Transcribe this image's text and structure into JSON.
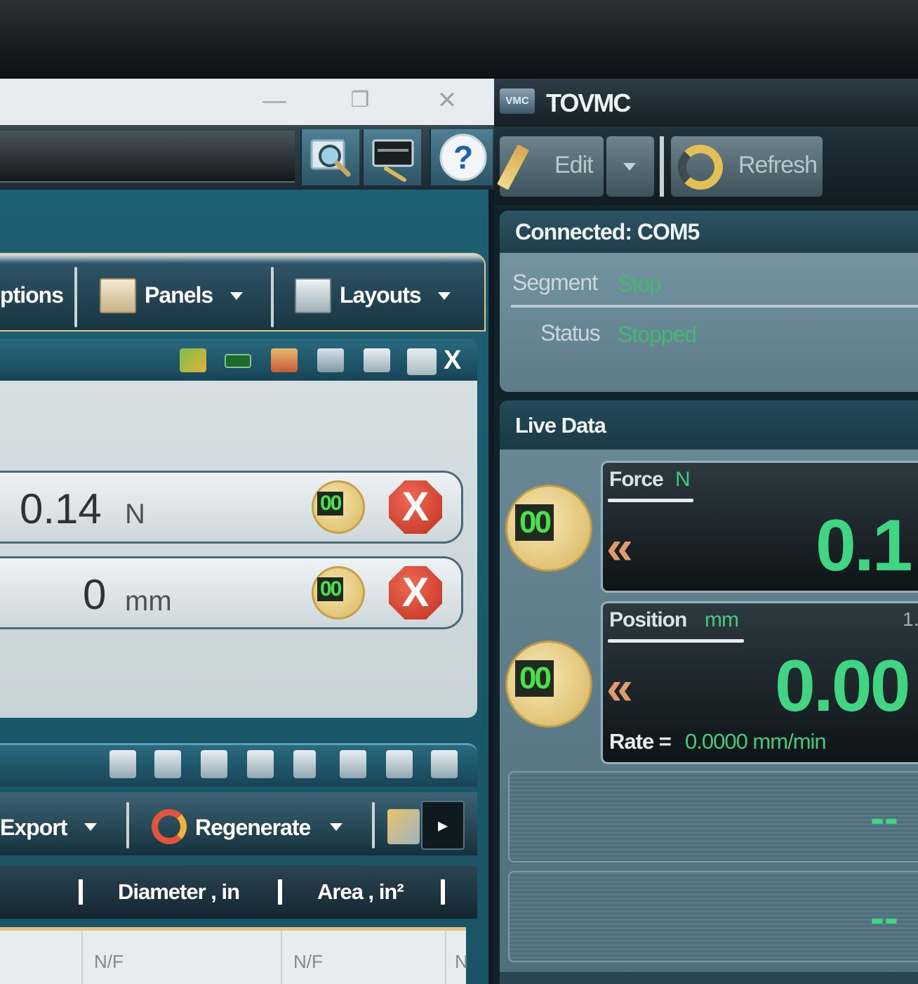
{
  "left_window": {
    "controls": {
      "minimize": "—",
      "maximize": "❐",
      "close": "✕"
    },
    "ribbon": {
      "options_label": "ptions",
      "panels_label": "Panels",
      "layouts_label": "Layouts"
    },
    "panel_close": "X",
    "readouts": [
      {
        "value": "0.14",
        "unit": "N"
      },
      {
        "value": "0",
        "unit": "mm"
      }
    ],
    "zero_icon_text": "00",
    "reset_icon_text": "X",
    "lower": {
      "export_label": "Export",
      "regenerate_label": "Regenerate",
      "more_label": "▸",
      "columns": [
        "Diameter , in",
        "Area , in²"
      ],
      "rows": [
        [
          "N/F",
          "N/F",
          "N"
        ]
      ]
    }
  },
  "right_window": {
    "title": "TOVMC",
    "logo_text": "VMC",
    "toolbar": {
      "edit_label": "Edit",
      "refresh_label": "Refresh"
    },
    "connection": {
      "title": "Connected: COM5",
      "segment_label": "Segment",
      "segment_value": "Stop",
      "status_label": "Status",
      "status_value": "Stopped"
    },
    "live_data": {
      "title": "Live Data",
      "force": {
        "label": "Force",
        "unit": "N",
        "value": "0.1",
        "corner": ""
      },
      "position": {
        "label": "Position",
        "unit": "mm",
        "value": "0.00",
        "corner": "1.",
        "rate_label": "Rate =",
        "rate_value": "0.0000 mm/min"
      },
      "empty_value": "--"
    }
  },
  "colors": {
    "accent_green": "#3fd582",
    "panel_teal": "#1d5f73",
    "stop_red": "#c0301f"
  }
}
